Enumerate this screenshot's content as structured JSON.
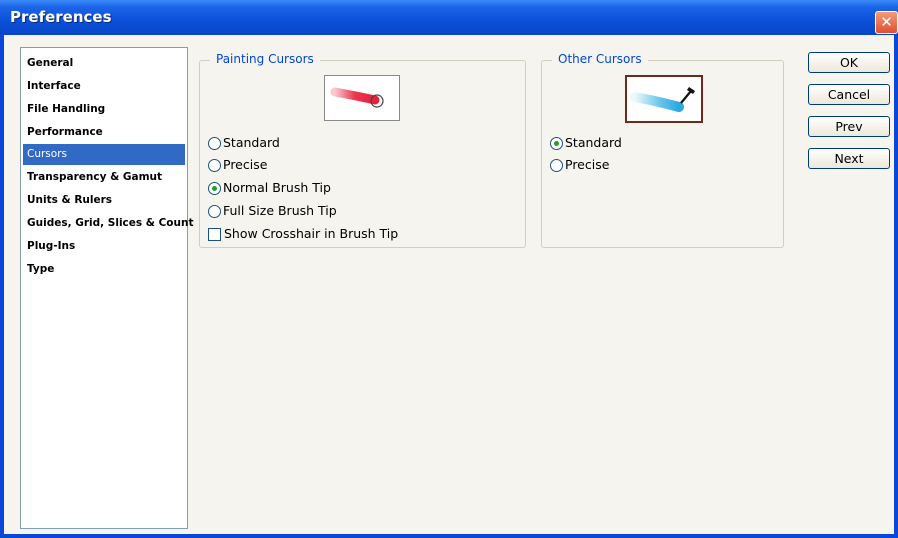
{
  "window": {
    "title": "Preferences",
    "close_glyph": "✕"
  },
  "sidebar": {
    "items": [
      {
        "label": "General",
        "selected": false
      },
      {
        "label": "Interface",
        "selected": false
      },
      {
        "label": "File Handling",
        "selected": false
      },
      {
        "label": "Performance",
        "selected": false
      },
      {
        "label": "Cursors",
        "selected": true
      },
      {
        "label": "Transparency & Gamut",
        "selected": false
      },
      {
        "label": "Units & Rulers",
        "selected": false
      },
      {
        "label": "Guides, Grid, Slices & Count",
        "selected": false
      },
      {
        "label": "Plug-Ins",
        "selected": false
      },
      {
        "label": "Type",
        "selected": false
      }
    ]
  },
  "painting_cursors": {
    "title": "Painting Cursors",
    "options": [
      {
        "label": "Standard",
        "checked": false
      },
      {
        "label": "Precise",
        "checked": false
      },
      {
        "label": "Normal Brush Tip",
        "checked": true
      },
      {
        "label": "Full Size Brush Tip",
        "checked": false
      }
    ],
    "crosshair": {
      "label": "Show Crosshair in Brush Tip",
      "checked": false
    },
    "preview_icon": "brush-stroke-icon",
    "stroke_color": "#e8203c"
  },
  "other_cursors": {
    "title": "Other Cursors",
    "options": [
      {
        "label": "Standard",
        "checked": true
      },
      {
        "label": "Precise",
        "checked": false
      }
    ],
    "preview_icon": "eyedropper-icon",
    "stroke_color": "#3cb4e6"
  },
  "buttons": {
    "ok": "OK",
    "cancel": "Cancel",
    "prev": "Prev",
    "next": "Next"
  },
  "colors": {
    "title_bar": "#0a50d8",
    "selection": "#316ac5",
    "group_title": "#0046d5",
    "radio_dot": "#21a121"
  }
}
